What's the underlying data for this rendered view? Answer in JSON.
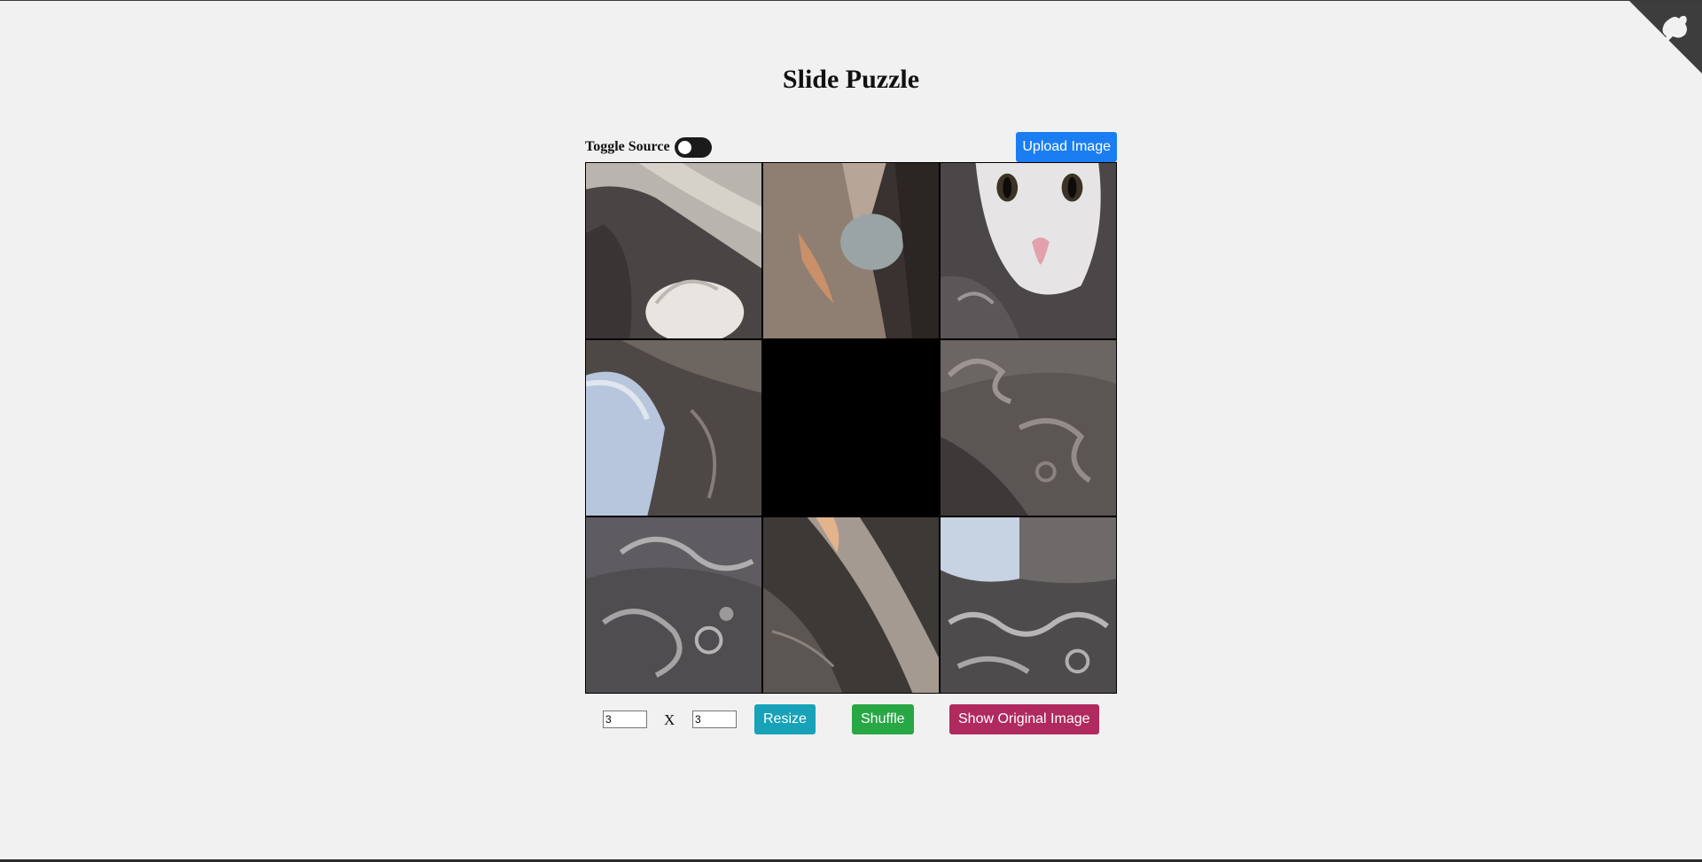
{
  "page": {
    "title": "Slide Puzzle"
  },
  "toolbar": {
    "toggle_label": "Toggle Source",
    "toggle_on": false,
    "upload_label": "Upload Image"
  },
  "board": {
    "rows": 3,
    "cols": 3,
    "empty_tile_index": 4
  },
  "controls": {
    "rows_value": "3",
    "cols_value": "3",
    "separator": "X",
    "resize_label": "Resize",
    "shuffle_label": "Shuffle",
    "show_original_label": "Show Original Image"
  },
  "colors": {
    "background": "#f1f1f1",
    "upload": "#1a7ef2",
    "resize": "#17a2b8",
    "shuffle": "#28a745",
    "show_original": "#b02a5f"
  },
  "icons": {
    "corner": "github-octocat-corner-icon"
  }
}
